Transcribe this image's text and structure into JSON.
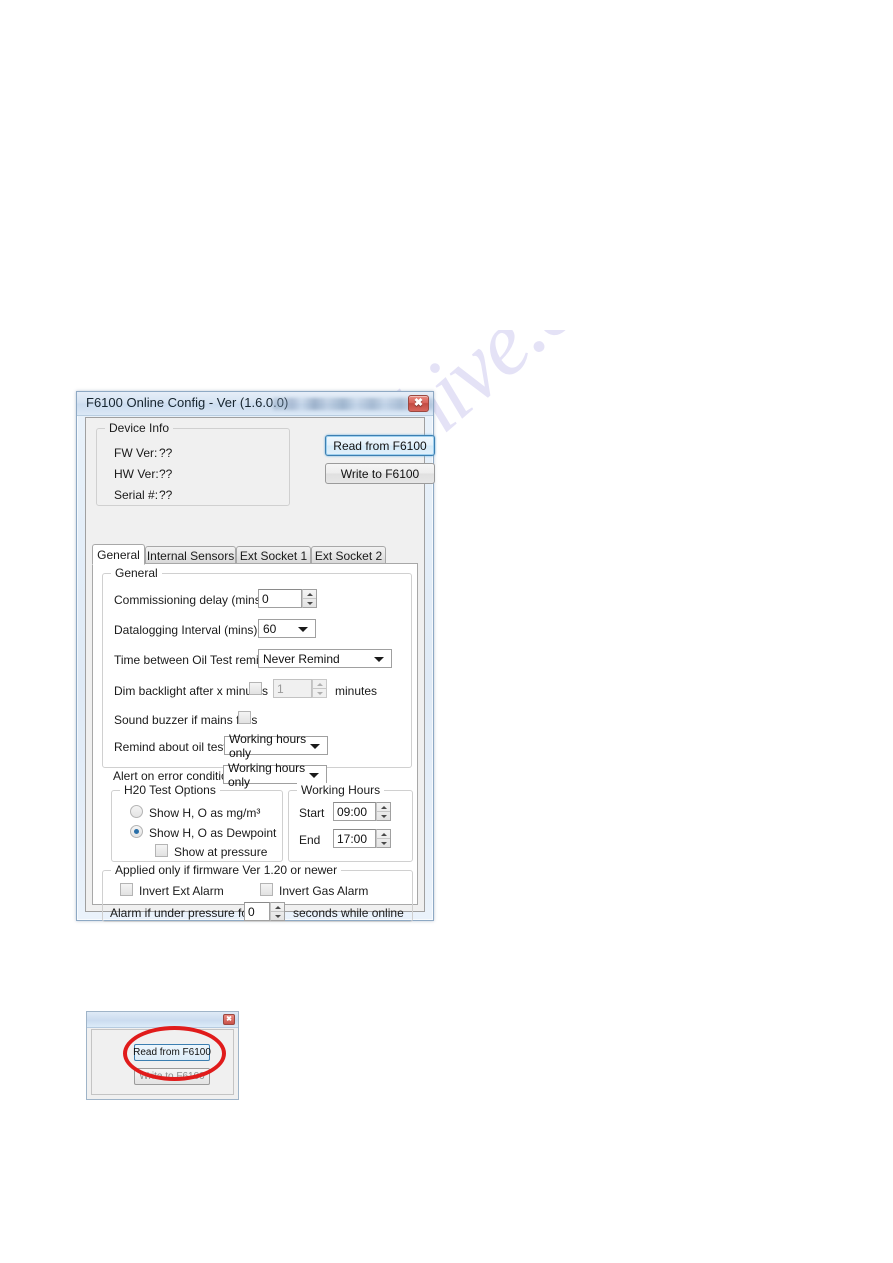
{
  "watermark": {
    "text": "manualshive.com"
  },
  "window": {
    "title": "F6100 Online Config - Ver (1.6.0.0)",
    "close_icon": "close-icon",
    "redacted_title_suffix": ""
  },
  "device_info": {
    "group_label": "Device Info",
    "rows": [
      {
        "label": "FW Ver:",
        "value": "??"
      },
      {
        "label": "HW Ver:",
        "value": "??"
      },
      {
        "label": "Serial #:",
        "value": "??"
      }
    ]
  },
  "actions": {
    "read_label": "Read from F6100",
    "write_label": "Write to F6100"
  },
  "tabs": [
    {
      "label": "General",
      "active": true
    },
    {
      "label": "Internal Sensors",
      "active": false
    },
    {
      "label": "Ext Socket 1",
      "active": false
    },
    {
      "label": "Ext Socket 2",
      "active": false
    }
  ],
  "general": {
    "group_label": "General",
    "commissioning_delay": {
      "label": "Commissioning delay (mins)",
      "value": "0"
    },
    "datalogging_interval": {
      "label": "Datalogging Interval (mins)",
      "value": "60"
    },
    "oil_test_reminders": {
      "label": "Time between Oil Test reminders",
      "value": "Never Remind"
    },
    "dim_backlight": {
      "label": "Dim backlight after x minutes",
      "checked": false,
      "value": "1",
      "suffix": "minutes"
    },
    "sound_buzzer": {
      "label": "Sound buzzer if mains fails",
      "checked": false
    },
    "remind_oil_test": {
      "label": "Remind about oil test",
      "value": "Working hours only"
    },
    "alert_error": {
      "label": "Alert on error condition",
      "value": "Working hours only"
    }
  },
  "h2o_options": {
    "group_label": "H20 Test Options",
    "radio_mgm3": {
      "label": "Show H, O as mg/m³",
      "checked": false
    },
    "radio_dewpoint": {
      "label": "Show H, O as Dewpoint",
      "checked": true
    },
    "show_at_pressure": {
      "label": "Show at pressure",
      "checked": false
    }
  },
  "working_hours": {
    "group_label": "Working Hours",
    "start": {
      "label": "Start",
      "value": "09:00"
    },
    "end": {
      "label": "End",
      "value": "17:00"
    }
  },
  "firmware_group": {
    "group_label": "Applied only if firmware Ver 1.20 or newer",
    "invert_ext_alarm": {
      "label": "Invert Ext Alarm",
      "checked": false
    },
    "invert_gas_alarm": {
      "label": "Invert Gas Alarm",
      "checked": false
    },
    "under_pressure": {
      "prefix": "Alarm if under pressure for",
      "value": "0",
      "suffix": "seconds while online"
    }
  },
  "annotation": {
    "read_label": "Read from F6100",
    "write_label": "Write to F6100",
    "close_icon": "close-icon",
    "highlight_color": "#e01b1b"
  }
}
